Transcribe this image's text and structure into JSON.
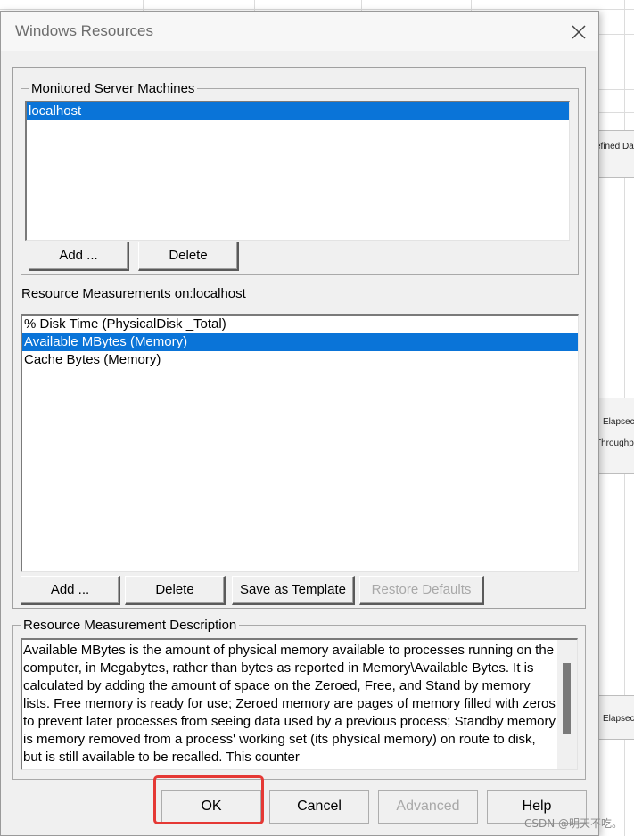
{
  "dialog": {
    "title": "Windows Resources"
  },
  "background": {
    "labels": [
      "efined Da",
      "Elapsec",
      "Throughp",
      "Elapsec"
    ]
  },
  "monitored": {
    "legend": "Monitored Server Machines",
    "items": [
      {
        "label": "localhost",
        "selected": true
      }
    ],
    "add_label": "Add ...",
    "delete_label": "Delete"
  },
  "measurements": {
    "title": "Resource Measurements on:localhost",
    "items": [
      {
        "label": "% Disk Time (PhysicalDisk _Total)",
        "selected": false
      },
      {
        "label": "Available MBytes (Memory)",
        "selected": true
      },
      {
        "label": "Cache Bytes (Memory)",
        "selected": false
      }
    ],
    "add_label": "Add ...",
    "delete_label": "Delete",
    "save_template_label": "Save as Template",
    "restore_defaults_label": "Restore Defaults"
  },
  "description": {
    "legend": "Resource Measurement Description",
    "text": "Available MBytes is the amount of physical memory available to processes running on the computer, in Megabytes, rather than bytes as reported in Memory\\Available Bytes. It is calculated by adding the amount of space on the Zeroed, Free, and Stand by memory lists. Free memory is ready for use; Zeroed memory are pages of memory filled with zeros to prevent later processes from seeing data used by a previous process; Standby memory is memory removed from a process' working set (its physical memory) on route to disk, but is still available to be recalled.  This counter"
  },
  "buttons": {
    "ok": "OK",
    "cancel": "Cancel",
    "advanced": "Advanced",
    "help": "Help"
  },
  "watermark": "CSDN @明天不吃。",
  "colors": {
    "selection": "#0a74d8",
    "highlight": "#e53935"
  },
  "icons": {
    "close": "close-icon"
  }
}
